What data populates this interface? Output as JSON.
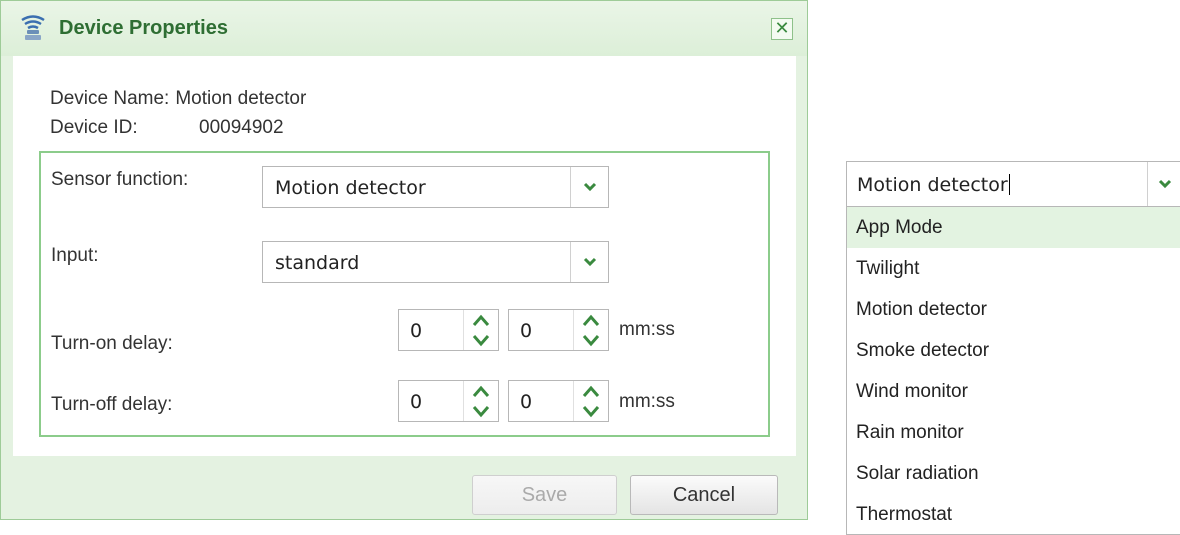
{
  "dialog": {
    "title": "Device Properties",
    "close_glyph": "✕",
    "device_name_label": "Device Name:",
    "device_name": "Motion detector",
    "device_id_label": "Device ID:",
    "device_id": "00094902",
    "sensor_function_label": "Sensor function:",
    "sensor_function_value": "Motion detector",
    "input_label": "Input:",
    "input_value": "standard",
    "turn_on_label": "Turn-on delay:",
    "turn_on_minutes": "0",
    "turn_on_seconds": "0",
    "turn_off_label": "Turn-off delay:",
    "turn_off_minutes": "0",
    "turn_off_seconds": "0",
    "unit_label": "mm:ss",
    "save_label": "Save",
    "cancel_label": "Cancel"
  },
  "dropdown": {
    "current_value": "Motion detector",
    "options": [
      "App Mode",
      "Twilight",
      "Motion detector",
      "Smoke detector",
      "Wind monitor",
      "Rain monitor",
      "Solar radiation",
      "Thermostat"
    ],
    "highlighted_option": "App Mode"
  },
  "colors": {
    "accent_green": "#2e6e33",
    "dialog_bg": "#e4f2e1",
    "border_green": "#8ccc8b",
    "highlight": "#e3f3e1"
  },
  "icons": {
    "title": "sensor-icon",
    "close": "close-icon",
    "dropdown_arrow": "chevron-down-icon",
    "spin_up": "chevron-up-icon",
    "spin_down": "chevron-down-icon"
  }
}
